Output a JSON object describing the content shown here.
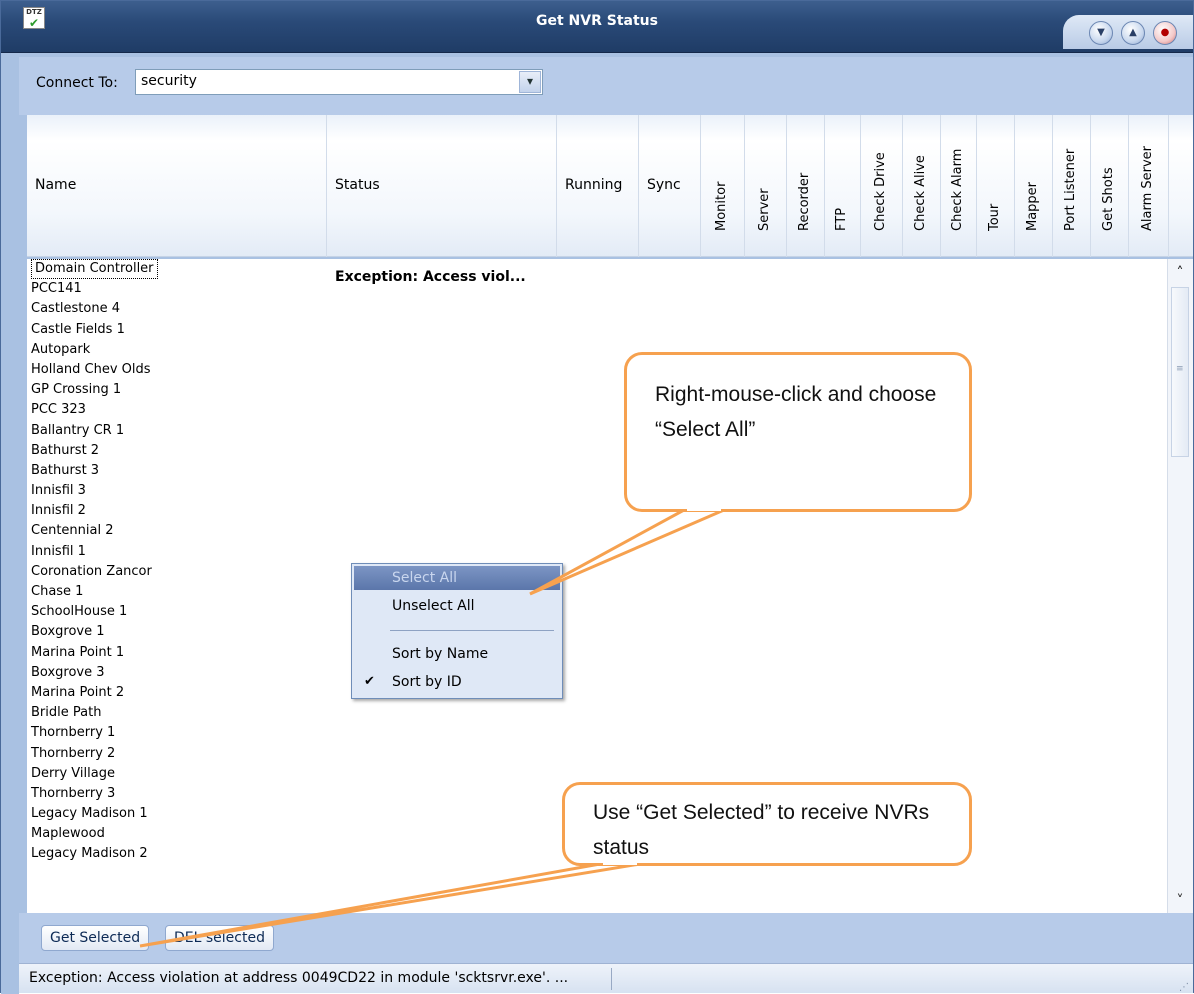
{
  "window": {
    "title": "Get NVR Status",
    "icon_text": "DTZ",
    "buttons": [
      "minimize-icon",
      "maximize-icon",
      "close-icon"
    ]
  },
  "connect": {
    "label": "Connect To:",
    "value": "security"
  },
  "columns": {
    "name": "Name",
    "status": "Status",
    "running": "Running",
    "sync": "Sync",
    "monitor": "Monitor",
    "server": "Server",
    "recorder": "Recorder",
    "ftp": "FTP",
    "check_drive": "Check Drive",
    "check_alive": "Check Alive",
    "check_alarm": "Check Alarm",
    "tour": "Tour",
    "mapper": "Mapper",
    "port_listener": "Port Listener",
    "get_shots": "Get Shots",
    "alarm_server": "Alarm Server"
  },
  "rows": [
    "Domain Controller",
    "PCC141",
    "Castlestone 4",
    "Castle Fields 1",
    "Autopark",
    "Holland Chev Olds",
    "GP Crossing 1",
    "PCC 323",
    "Ballantry CR 1",
    "Bathurst 2",
    "Bathurst 3",
    "Innisfil 3",
    "Innisfil 2",
    "Centennial 2",
    "Innisfil 1",
    "Coronation Zancor",
    "Chase 1",
    "SchoolHouse 1",
    "Boxgrove 1",
    "Marina Point 1",
    "Boxgrove 3",
    "Marina Point 2",
    "Bridle Path",
    "Thornberry 1",
    "Thornberry 2",
    "Derry Village",
    "Thornberry 3",
    "Legacy Madison 1",
    "Maplewood",
    "Legacy Madison 2"
  ],
  "first_row_status": "Exception: Access viol...",
  "context_menu": {
    "select_all": "Select All",
    "unselect_all": "Unselect All",
    "sort_by_name": "Sort by Name",
    "sort_by_id": "Sort by ID",
    "checked": "sort_by_id"
  },
  "callouts": {
    "select_all": "Right-mouse-click and choose “Select All”",
    "get_selected": "Use “Get Selected” to receive NVRs status"
  },
  "footer": {
    "get_selected": "Get Selected",
    "del_selected": "DEL selected"
  },
  "statusbar": {
    "text": "Exception: Access violation at address 0049CD22 in module 'scktsrvr.exe'. ..."
  },
  "colors": {
    "title_bar": "#2a4a78",
    "panel": "#b7cbe9",
    "callout_border": "#f6a14f",
    "menu_highlight": "#5b76aa"
  }
}
